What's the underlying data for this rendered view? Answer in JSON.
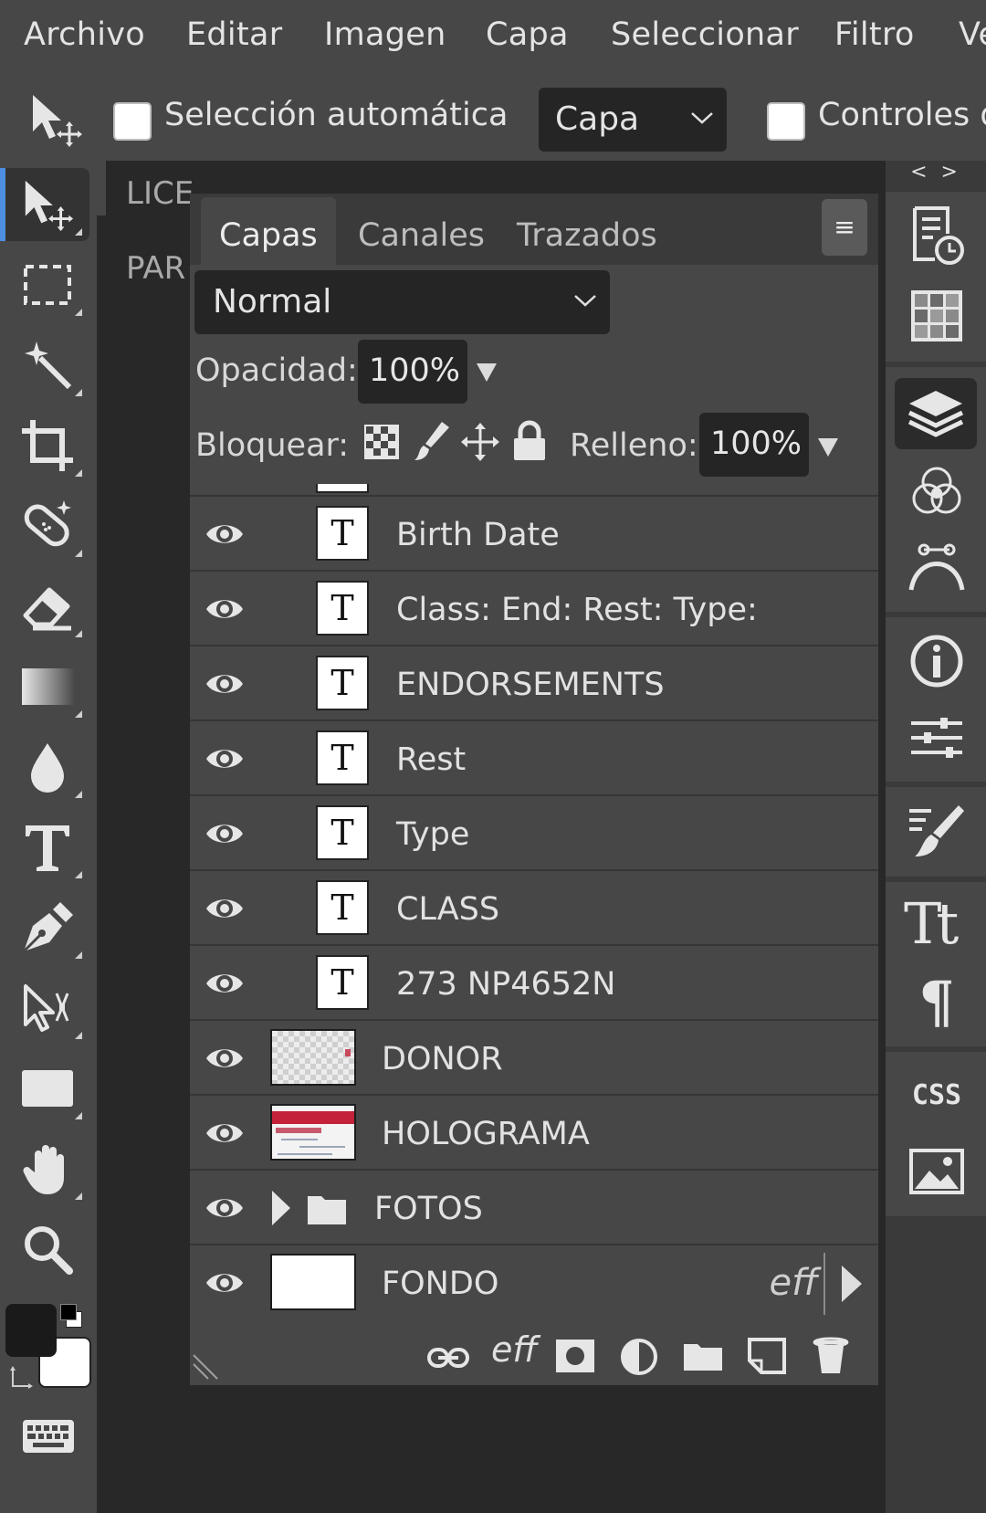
{
  "menu": {
    "items": [
      "Archivo",
      "Editar",
      "Imagen",
      "Capa",
      "Seleccionar",
      "Filtro",
      "Ve"
    ]
  },
  "options": {
    "auto_select_label": "Selección automática",
    "auto_select_checked": false,
    "target_select_value": "Capa",
    "transform_controls_label": "Controles d",
    "transform_controls_checked": false
  },
  "tools": [
    {
      "name": "move-tool",
      "icon": "move-arrow-icon",
      "active": true
    },
    {
      "name": "marquee-tool",
      "icon": "dashed-rectangle-icon"
    },
    {
      "name": "magic-wand-tool",
      "icon": "magic-wand-icon"
    },
    {
      "name": "crop-tool",
      "icon": "crop-icon"
    },
    {
      "name": "healing-brush-tool",
      "icon": "bandage-icon"
    },
    {
      "name": "eraser-tool",
      "icon": "eraser-icon"
    },
    {
      "name": "gradient-tool",
      "icon": "gradient-icon"
    },
    {
      "name": "blur-tool",
      "icon": "drop-icon"
    },
    {
      "name": "type-tool",
      "icon": "text-t-icon"
    },
    {
      "name": "pen-tool",
      "icon": "pen-nib-icon"
    },
    {
      "name": "path-select-tool",
      "icon": "path-select-icon"
    },
    {
      "name": "shape-tool",
      "icon": "rectangle-shape-icon"
    },
    {
      "name": "hand-tool",
      "icon": "hand-icon"
    },
    {
      "name": "zoom-tool",
      "icon": "magnifier-icon"
    }
  ],
  "colors": {
    "foreground": "#1a1a1a",
    "background": "#ffffff",
    "accent": "#4d8fe0"
  },
  "document": {
    "tabs": [
      "LICE",
      "PAR"
    ]
  },
  "dock": {
    "collapse_arrows": "< >",
    "icons": [
      "history-icon",
      "swatches-icon",
      "layers-icon",
      "channels-icon",
      "paths-icon",
      "info-icon",
      "adjustments-icon",
      "brush-settings-icon",
      "character-icon",
      "paragraph-icon",
      "css-icon",
      "image-icon"
    ],
    "css_label": "CSS",
    "character_label": "Tt",
    "paragraph_label": "¶"
  },
  "layers_panel": {
    "tabs": [
      "Capas",
      "Canales",
      "Trazados"
    ],
    "active_tab": "Capas",
    "menu_glyph": "≡",
    "blend_mode": "Normal",
    "opacity_label": "Opacidad:",
    "opacity_value": "100%",
    "lock_label": "Bloquear:",
    "fill_label": "Relleno:",
    "fill_value": "100%",
    "text_thumb_glyph": "T",
    "effects_label": "eff",
    "layers": [
      {
        "name": "Birth Date",
        "type": "text",
        "visible": true
      },
      {
        "name": "Class: End: Rest: Type:",
        "type": "text",
        "visible": true
      },
      {
        "name": "ENDORSEMENTS",
        "type": "text",
        "visible": true
      },
      {
        "name": "Rest",
        "type": "text",
        "visible": true
      },
      {
        "name": "Type",
        "type": "text",
        "visible": true
      },
      {
        "name": "CLASS",
        "type": "text",
        "visible": true
      },
      {
        "name": "273 NP4652N",
        "type": "text",
        "visible": true
      },
      {
        "name": "DONOR",
        "type": "image-transparent",
        "visible": true
      },
      {
        "name": "HOLOGRAMA",
        "type": "image",
        "visible": true
      },
      {
        "name": "FOTOS",
        "type": "folder",
        "visible": true
      },
      {
        "name": "FONDO",
        "type": "image-white",
        "visible": true,
        "has_effects": true
      }
    ],
    "footer_icons": [
      "link-icon",
      "effects-icon",
      "mask-icon",
      "adjustment-layer-icon",
      "new-folder-icon",
      "new-layer-icon",
      "trash-icon"
    ]
  }
}
